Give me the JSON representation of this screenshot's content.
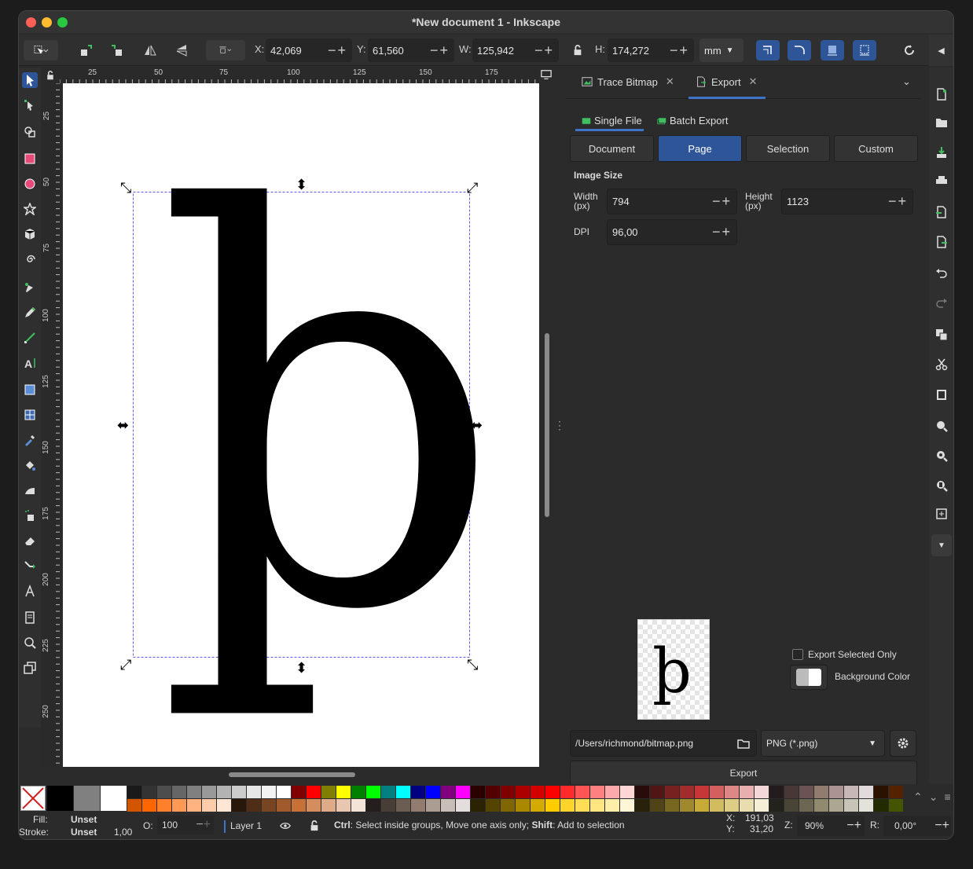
{
  "window": {
    "title": "*New document 1 - Inkscape"
  },
  "toolbar": {
    "x_label": "X:",
    "x_value": "42,069",
    "y_label": "Y:",
    "y_value": "61,560",
    "w_label": "W:",
    "w_value": "125,942",
    "h_label": "H:",
    "h_value": "174,272",
    "unit": "mm"
  },
  "rulers": {
    "top": [
      "25",
      "50",
      "75",
      "100",
      "125",
      "150",
      "175"
    ],
    "left": [
      "25",
      "50",
      "75",
      "100",
      "125",
      "150",
      "175",
      "200",
      "225",
      "250"
    ]
  },
  "canvas": {
    "glyph": "þ"
  },
  "panel": {
    "tab_trace": "Trace Bitmap",
    "tab_export": "Export",
    "subtab_single": "Single File",
    "subtab_batch": "Batch Export",
    "modes": [
      "Document",
      "Page",
      "Selection",
      "Custom"
    ],
    "active_mode": "Page",
    "image_size_label": "Image Size",
    "width_label": "Width\n(px)",
    "width_value": "794",
    "height_label": "Height\n(px)",
    "height_value": "1123",
    "dpi_label": "DPI",
    "dpi_value": "96,00",
    "export_selected_only": "Export Selected Only",
    "background_color": "Background Color",
    "filename": "/Users/richmond/bitmap.png",
    "format": "PNG (*.png)",
    "export_button": "Export"
  },
  "status": {
    "fill_label": "Fill:",
    "fill_value": "Unset",
    "stroke_label": "Stroke:",
    "stroke_value": "Unset",
    "stroke_width": "1,00",
    "opacity_label": "O:",
    "opacity_value": "100",
    "layer": "Layer 1",
    "hint_bold1": "Ctrl",
    "hint_text1": ": Select inside groups, Move one axis only; ",
    "hint_bold2": "Shift",
    "hint_text2": ": Add to selection",
    "coord_x_label": "X:",
    "coord_x": "191,03",
    "coord_y_label": "Y:",
    "coord_y": "31,20",
    "zoom_label": "Z:",
    "zoom": "90%",
    "rotate_label": "R:",
    "rotate": "0,00°"
  },
  "palette_colors_top": [
    "#000000",
    "#808080",
    "#ffffff",
    "#1a1a1a",
    "#333333",
    "#4d4d4d",
    "#666666",
    "#808080",
    "#999999",
    "#b3b3b3",
    "#cccccc",
    "#e6e6e6",
    "#f2f2f2",
    "#ffffff",
    "#800000",
    "#ff0000",
    "#808000",
    "#ffff00",
    "#008000",
    "#00ff00",
    "#008080",
    "#00ffff",
    "#000080",
    "#0000ff",
    "#800080",
    "#ff00ff",
    "#2b0000",
    "#550000",
    "#800000",
    "#aa0000",
    "#d40000",
    "#ff0000",
    "#ff2a2a",
    "#ff5555",
    "#ff8080",
    "#ffaaaa",
    "#ffd5d5",
    "#280b0b",
    "#501616",
    "#782121",
    "#a02c2c",
    "#c83737",
    "#d35f5f",
    "#de8787",
    "#e9afaf",
    "#f4d7d7",
    "#241c1c",
    "#483737",
    "#6c5353",
    "#917c6f",
    "#ac9393",
    "#c8b7b7",
    "#e3dbdb",
    "#2b1100",
    "#552200",
    "#803300",
    "#aa4400"
  ],
  "palette_colors_bottom": [
    "#d45500",
    "#ff6600",
    "#ff7f2a",
    "#ff9955",
    "#ffb380",
    "#ffccaa",
    "#ffe6d5",
    "#28170b",
    "#502d16",
    "#784421",
    "#a05a2c",
    "#c87137",
    "#d38d5f",
    "#deaa87",
    "#e9c6af",
    "#f4e3d7",
    "#241f1c",
    "#483e37",
    "#6c5d53",
    "#917c6f",
    "#ac9d93",
    "#c8beb7",
    "#e3dedb",
    "#2b2200",
    "#554400",
    "#806600",
    "#aa8800",
    "#d4aa00",
    "#ffcc00",
    "#ffd42a",
    "#ffdd55",
    "#ffe680",
    "#ffeeaa",
    "#fff6d5",
    "#28220b",
    "#504416",
    "#786721",
    "#a0892c",
    "#c8ab37",
    "#d3bc5f",
    "#decd87",
    "#e9ddaf",
    "#f4eed7",
    "#24221c",
    "#484537",
    "#6c6753",
    "#918a6f",
    "#aca793",
    "#c8c4b7",
    "#e3e2db",
    "#222b00",
    "#445500",
    "#668000",
    "#88aa00"
  ]
}
